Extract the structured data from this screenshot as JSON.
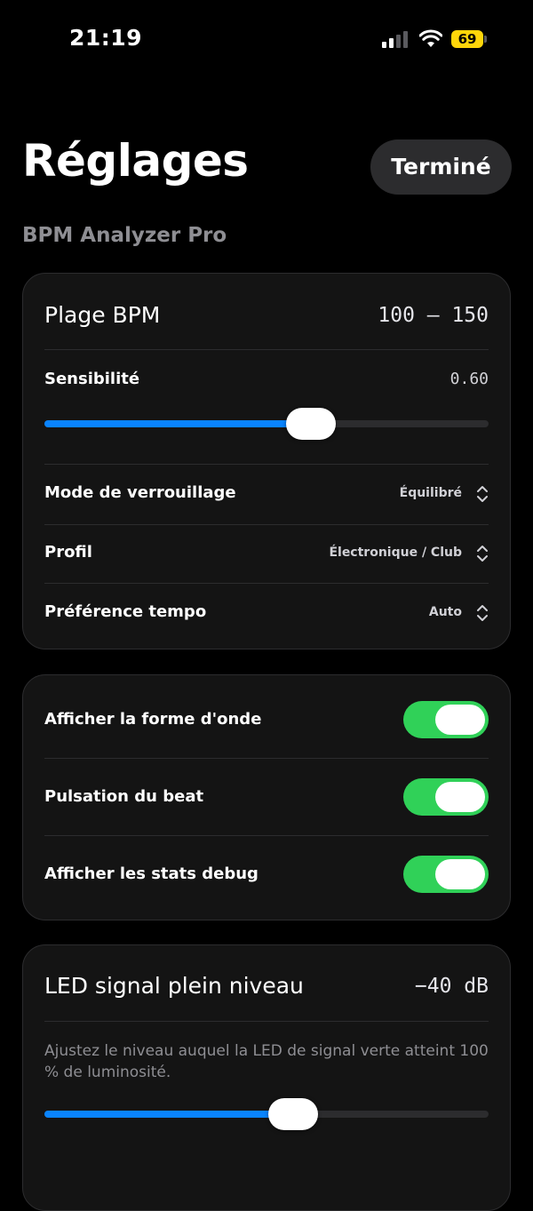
{
  "status_bar": {
    "time": "21:19",
    "battery_level": "69",
    "battery_color": "#ffd60a",
    "icons": [
      "signal-icon",
      "wifi-icon",
      "battery-icon"
    ]
  },
  "header": {
    "title": "Réglages",
    "done_label": "Terminé",
    "subtitle": "BPM Analyzer Pro"
  },
  "bpm_card": {
    "range_label": "Plage BPM",
    "range_value": "100 — 150",
    "sensitivity_label": "Sensibilité",
    "sensitivity_value": "0.60",
    "sensitivity_fraction": 0.6,
    "lock_mode_label": "Mode de verrouillage",
    "lock_mode_value": "Équilibré",
    "profile_label": "Profil",
    "profile_value": "Électronique / Club",
    "tempo_pref_label": "Préférence tempo",
    "tempo_pref_value": "Auto"
  },
  "display_card": {
    "waveform_label": "Afficher la forme d'onde",
    "waveform_on": true,
    "beat_pulse_label": "Pulsation du beat",
    "beat_pulse_on": true,
    "debug_stats_label": "Afficher les stats debug",
    "debug_stats_on": true
  },
  "led_card": {
    "title": "LED signal plein niveau",
    "value": "−40 dB",
    "description": "Ajustez le niveau auquel la LED de signal verte atteint 100 % de luminosité.",
    "level_fraction": 0.56
  },
  "colors": {
    "accent_blue": "#0a84ff",
    "toggle_green": "#30d158",
    "card_background": "#141414"
  }
}
